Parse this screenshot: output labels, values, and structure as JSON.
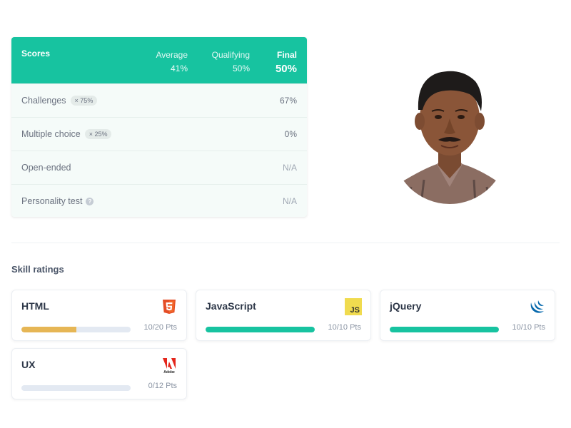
{
  "scores": {
    "title": "Scores",
    "average_label": "Average",
    "average_value": "41%",
    "qualifying_label": "Qualifying",
    "qualifying_value": "50%",
    "final_label": "Final",
    "final_value": "50%",
    "rows": [
      {
        "label": "Challenges",
        "badge": "× 75%",
        "value": "67%"
      },
      {
        "label": "Multiple choice",
        "badge": "× 25%",
        "value": "0%"
      },
      {
        "label": "Open-ended",
        "value": "N/A"
      },
      {
        "label": "Personality test",
        "value": "N/A"
      }
    ]
  },
  "skills": {
    "title": "Skill ratings",
    "items": [
      {
        "name": "HTML",
        "icon": "html5-icon",
        "points": "10/20 Pts",
        "progress": 0.5,
        "color": "#e6b655"
      },
      {
        "name": "JavaScript",
        "icon": "javascript-icon",
        "points": "10/10 Pts",
        "progress": 1.0,
        "color": "#17c3a0"
      },
      {
        "name": "jQuery",
        "icon": "jquery-icon",
        "points": "10/10 Pts",
        "progress": 1.0,
        "color": "#17c3a0"
      },
      {
        "name": "UX",
        "icon": "adobe-icon",
        "points": "0/12 Pts",
        "progress": 0.0,
        "color": "#17c3a0"
      }
    ]
  },
  "colors": {
    "accent": "#17c3a0",
    "html_bar": "#e6b655",
    "html5": "#e44d26",
    "js_yellow": "#f0db4f",
    "jquery_blue": "#0769ad",
    "adobe_red": "#e4261b"
  }
}
